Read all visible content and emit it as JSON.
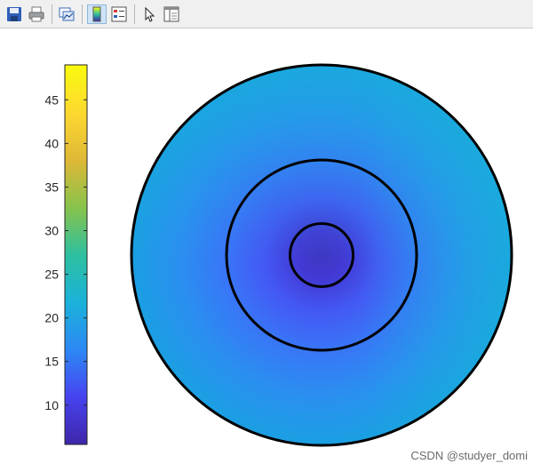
{
  "toolbar": {
    "buttons": [
      {
        "id": "save",
        "icon": "save-icon"
      },
      {
        "id": "print",
        "icon": "print-icon"
      },
      {
        "id": "link-plot",
        "icon": "link-plot-icon"
      },
      {
        "id": "colorbar",
        "icon": "colorbar-icon",
        "active": true
      },
      {
        "id": "legend",
        "icon": "legend-icon"
      },
      {
        "id": "pointer",
        "icon": "pointer-icon"
      },
      {
        "id": "property-editor",
        "icon": "property-editor-icon"
      }
    ]
  },
  "colorbar": {
    "min": 5.5,
    "max": 49,
    "ticks": [
      "10",
      "15",
      "20",
      "25",
      "30",
      "35",
      "40",
      "45"
    ],
    "tick_values": [
      10,
      15,
      20,
      25,
      30,
      35,
      40,
      45
    ],
    "colormap": [
      "#3e26a8",
      "#4743f0",
      "#2c89f4",
      "#1ab2da",
      "#2ec09f",
      "#89c34b",
      "#dfb836",
      "#fdd930",
      "#f9fb0e"
    ]
  },
  "chart_data": {
    "type": "heatmap",
    "shape": "polar-disk",
    "title": "",
    "description_values": {
      "center_value": 6,
      "inner_ring_value": 13,
      "middle_ring_value": 18,
      "outer_edge_value": 22
    },
    "boundary_circles_relative_radius": [
      0.165,
      0.5,
      1.0
    ],
    "colorbar_range": [
      5.5,
      49
    ]
  },
  "watermark": "CSDN @studyer_domi"
}
